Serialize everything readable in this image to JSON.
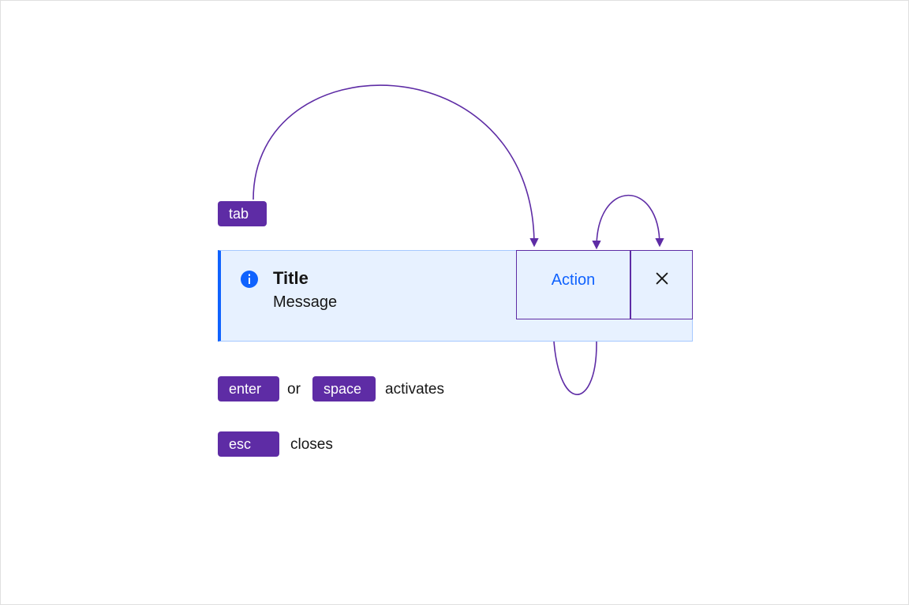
{
  "keys": {
    "tab": "tab",
    "enter": "enter",
    "space": "space",
    "esc": "esc"
  },
  "captions": {
    "or": "or",
    "activates": "activates",
    "closes": "closes"
  },
  "notification": {
    "title": "Title",
    "message": "Message",
    "action_label": "Action"
  },
  "icons": {
    "info": "info-icon",
    "close": "close-icon"
  },
  "colors": {
    "key_bg": "#5e2ca5",
    "key_fg": "#ffffff",
    "flow_stroke": "#5e2ca5",
    "notif_bg": "#e7f1ff",
    "notif_border": "#a6c8ff",
    "notif_accent": "#0f62fe",
    "action_fg": "#0f62fe",
    "focus_border": "#5e2ca5",
    "text": "#161616"
  }
}
